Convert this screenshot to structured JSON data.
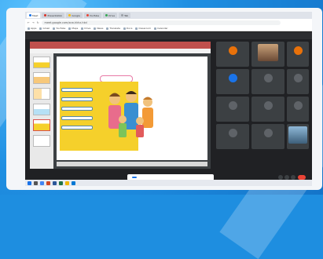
{
  "browser": {
    "tabs": [
      {
        "label": "Meet",
        "active": true,
        "color": "#1a73e8"
      },
      {
        "label": "Presentation",
        "active": false,
        "color": "#d93025"
      },
      {
        "label": "Google",
        "active": false,
        "color": "#fbbc04"
      },
      {
        "label": "YouTube",
        "active": false,
        "color": "#ea4335"
      },
      {
        "label": "Drive",
        "active": false,
        "color": "#34a853"
      },
      {
        "label": "Tab",
        "active": false,
        "color": "#9aa0a6"
      }
    ],
    "url": "meet.google.com/xcw-hkhz-hkd",
    "bookmarks": [
      "Apps",
      "Gmail",
      "YouTube",
      "Maps",
      "Drive",
      "News",
      "Translate",
      "Docs",
      "Classroom",
      "Calendar"
    ]
  },
  "meet": {
    "presenter_banner": "",
    "participants": [
      {
        "name": "",
        "initial": "",
        "color": "#e8710a",
        "type": "photo"
      },
      {
        "name": "",
        "initial": "",
        "color": "#9334e6",
        "type": "photo"
      },
      {
        "name": "",
        "initial": "",
        "color": "#e8710a",
        "type": "avatar"
      },
      {
        "name": "",
        "initial": "",
        "color": "#1a73e8",
        "type": "avatar"
      },
      {
        "name": "",
        "initial": "",
        "color": "#5f6368",
        "type": "photo"
      },
      {
        "name": "",
        "initial": "",
        "color": "#5f6368",
        "type": "photo"
      },
      {
        "name": "",
        "initial": "",
        "color": "#5f6368",
        "type": "photo"
      },
      {
        "name": "",
        "initial": "",
        "color": "#5f6368",
        "type": "photo"
      },
      {
        "name": "",
        "initial": "",
        "color": "#5f6368",
        "type": "photo"
      },
      {
        "name": "",
        "initial": "",
        "color": "#5f6368",
        "type": "photo"
      },
      {
        "name": "",
        "initial": "",
        "color": "#5f6368",
        "type": "photo"
      },
      {
        "name": "",
        "initial": "",
        "color": "#5f6368",
        "type": "photo"
      }
    ],
    "time": "",
    "notice_text": "",
    "notice_button": ""
  },
  "slide": {
    "title": "",
    "body": "",
    "pill": "",
    "labels": [
      "",
      "",
      "",
      "",
      ""
    ]
  },
  "colors": {
    "background": "#1e8ee0",
    "slide_yellow": "#f5d02b",
    "ppt_red": "#c0504d",
    "meet_dark": "#202124",
    "end_call": "#ea4335"
  }
}
